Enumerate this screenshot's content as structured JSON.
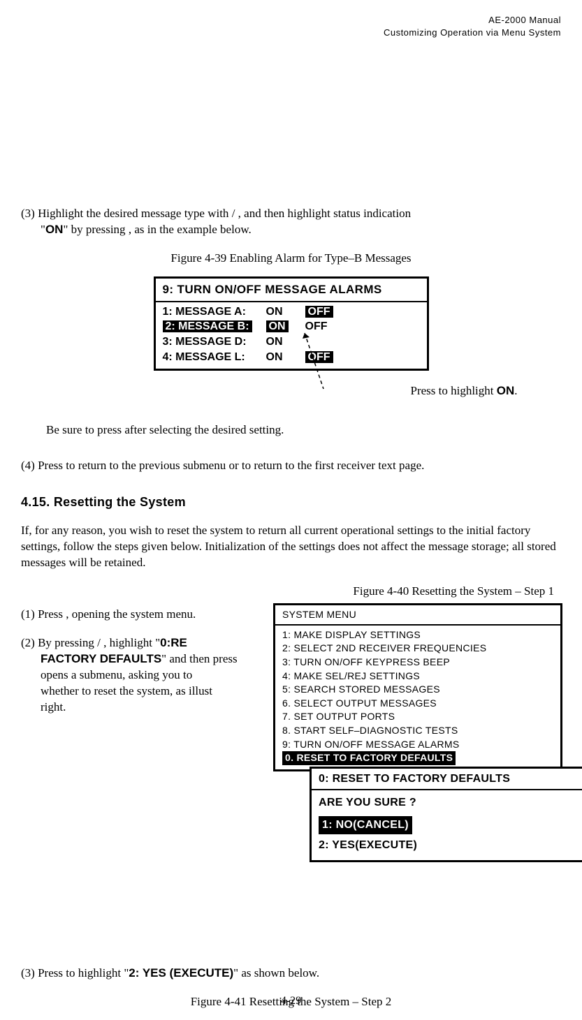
{
  "header": {
    "line1": "AE-2000 Manual",
    "line2": "Customizing Operation via Menu System"
  },
  "step3": {
    "pre": "(3) Highlight the desired message type with ",
    "slash": " / ",
    "mid": " , and then highlight status indication",
    "line2a": "\"",
    "on_word": "ON",
    "line2b": "\" by pressing ",
    "line2c": " , as in the example below."
  },
  "fig39": {
    "caption": "Figure 4-39   Enabling Alarm for Type–B Messages",
    "title": "9: TURN ON/OFF MESSAGE ALARMS",
    "rows": [
      {
        "label": "1: MESSAGE A:",
        "v1": "ON",
        "v2": "OFF",
        "hl_label": false,
        "hl_v1": false,
        "hl_v2": true
      },
      {
        "label": "2: MESSAGE B:",
        "v1": "ON",
        "v2": "OFF",
        "hl_label": true,
        "hl_v1": true,
        "hl_v2": false
      },
      {
        "label": "3: MESSAGE D:",
        "v1": "ON",
        "v2": "",
        "hl_label": false,
        "hl_v1": false,
        "hl_v2": false
      },
      {
        "label": "4: MESSAGE L:",
        "v1": "ON",
        "v2": "OFF",
        "hl_label": false,
        "hl_v1": false,
        "hl_v2": true
      }
    ],
    "press_to_highlight": "Press      to highlight ",
    "press_to_highlight_bold": "ON",
    "press_to_highlight_period": "."
  },
  "note_line": "Be sure to press        after selecting the desired setting.",
  "step4_line": "(4) Press        to return to the previous submenu or        to return to the first receiver text page.",
  "section": "4.15.  Resetting the System",
  "paragraph1": "If, for any reason, you wish to reset the system to return all current operational settings to the initial factory settings, follow the steps given below. Initialization of the settings does not affect the message storage; all stored messages will be retained.",
  "fig40_caption": "Figure 4-40   Resetting the System – Step 1",
  "step1": "(1) Press       , opening the system menu.",
  "step2": {
    "l1a": "(2) By pressing ",
    "l1slash": " / ",
    "l1b": " ,  highlight  \"",
    "bold1": "0:RE",
    "l2a": "FACTORY DEFAULTS",
    "l2b": "\" and  then  press",
    "l3": "opens   a   submenu,   asking   you   to",
    "l4": "whether  to  reset  the  system,  as  illust",
    "l5": "right."
  },
  "sysmenu": {
    "title": "SYSTEM MENU",
    "items": [
      "1:  MAKE DISPLAY SETTINGS",
      "2:   SELECT 2ND RECEIVER FREQUENCIES",
      "3:   TURN ON/OFF KEYPRESS BEEP",
      "4:   MAKE SEL/REJ SETTINGS",
      "5:   SEARCH STORED MESSAGES",
      "6.   SELECT OUTPUT MESSAGES",
      "7.   SET OUTPUT PORTS",
      "8.   START SELF–DIAGNOSTIC TESTS",
      "9:   TURN ON/OFF MESSAGE ALARMS"
    ],
    "highlighted": "0.   RESET TO FACTORY DEFAULTS"
  },
  "confirm": {
    "title": "0: RESET TO FACTORY DEFAULTS",
    "question": "ARE YOU SURE ?",
    "opt1": "1: NO(CANCEL)",
    "opt2": "2: YES(EXECUTE)"
  },
  "step3b": {
    "pre": "(3)  Press        to highlight \"",
    "bold": "2: YES (EXECUTE)",
    "post": "\" as shown below."
  },
  "fig41_caption": "Figure 4-41   Resetting the System – Step 2",
  "page_num": "4-29"
}
